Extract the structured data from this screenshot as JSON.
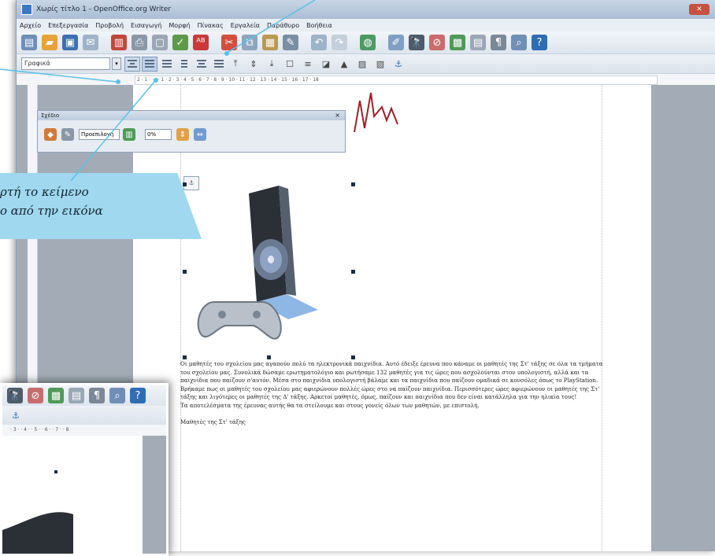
{
  "window": {
    "title": "Χωρίς τίτλο 1 - OpenOffice.org Writer"
  },
  "menu": [
    "Αρχείο",
    "Επεξεργασία",
    "Προβολή",
    "Εισαγωγή",
    "Μορφή",
    "Πίνακας",
    "Εργαλεία",
    "Παράθυρο",
    "Βοήθεια"
  ],
  "format_bar": {
    "style_value": "Γραφικά"
  },
  "ruler": {
    "ticks": "2 · 1 · · · · 1 · 2 · 3 · 4 · 5 · 6 · 7 · 8 · 9 · 10 · 11 · 12 · 13 · 14 · 15 · 16 · 17 · 18"
  },
  "drawing_dock": {
    "title": "Σχέδιο",
    "close": "×",
    "mode_value": "Προεπιλογή",
    "percent_value": "0%"
  },
  "callout": {
    "line1": "ρτή το κείμενο",
    "line2": "ο από την εικόνα"
  },
  "document": {
    "paragraphs": [
      "Οι μαθητές του σχολείου μας αγαπούν πολύ τα ηλεκτρονικά παιχνίδια. Αυτό έδειξε έρευνα που κάναμε οι μαθητές της Στ' τάξης σε όλα τα τμήματα του σχολείου μας. Συνολικά δώσαμε ερωτηματολόγιο και ρωτήσαμε 132 μαθητές για τις ώρες που ασχολούνται στον υπολογιστή, αλλά και τα παιχνίδια που παίζουν σ'αυτόν. Μέσα στο παιχνίδια υπολογιστή βάλαμε και τα παιχνίδια που παίζουν ομαδικά σε κονσόλες όπως το PlayStation.",
      "Βρήκαμε πως οι μαθητές του σχολείου μας αφιερώνουν πολλές ώρες στο να παίζουν παιχνίδια. Περισσότερες ώρες αφιερώνουν οι μαθητές της Στ' τάξης και λιγότερες οι μαθητές της Δ' τάξης. Αρκετοί μαθητές, όμως, παίζουν και παιχνίδια που δεν είναι κατάλληλα για την ηλικία τους!",
      "Τα αποτελέσματα της έρευνας αυτής θα τα στείλουμε και στους γονείς όλων των μαθητών, με επιστολή."
    ],
    "signature": "Μαθητές της Στ' τάξης"
  },
  "icons": {
    "anchor": "⚓",
    "zoom": "🔍",
    "help": "?",
    "nonprinting": "¶",
    "find": "🔭"
  },
  "colors": {
    "callout": "#9fd8ef",
    "leader": "#5bc0e8",
    "handle": "#1d2c40"
  }
}
